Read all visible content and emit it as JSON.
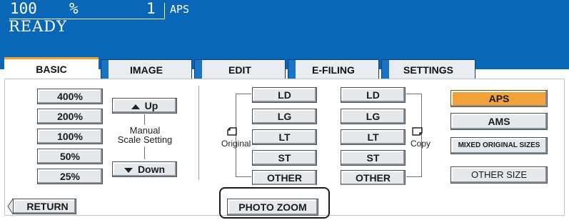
{
  "header": {
    "zoom_value": "100",
    "zoom_unit": "%",
    "copies": "1",
    "paper_mode": "APS",
    "status": "READY"
  },
  "tabs": [
    {
      "label": "BASIC",
      "active": true
    },
    {
      "label": "IMAGE",
      "active": false
    },
    {
      "label": "EDIT",
      "active": false
    },
    {
      "label": "E-FILING",
      "active": false
    },
    {
      "label": "SETTINGS",
      "active": false
    }
  ],
  "zoom_presets": [
    "400%",
    "200%",
    "100%",
    "50%",
    "25%"
  ],
  "manual_scale": {
    "up_label": "Up",
    "down_label": "Down",
    "label_line1": "Manual",
    "label_line2": "Scale Setting"
  },
  "original_sizes": [
    "LD",
    "LG",
    "LT",
    "ST",
    "OTHER"
  ],
  "original_label": "Original",
  "copy_sizes": [
    "LD",
    "LG",
    "LT",
    "ST",
    "OTHER"
  ],
  "copy_label": "Copy",
  "paper_select": {
    "aps": "APS",
    "ams": "AMS",
    "mixed": "MIXED ORIGINAL SIZES",
    "other_size": "OTHER SIZE"
  },
  "footer": {
    "return_label": "RETURN",
    "photo_zoom_label": "PHOTO ZOOM"
  },
  "colors": {
    "header_bg": "#0a67b7",
    "active_tab_accent": "#f0a030",
    "aps_selected": "#f3a23a"
  }
}
